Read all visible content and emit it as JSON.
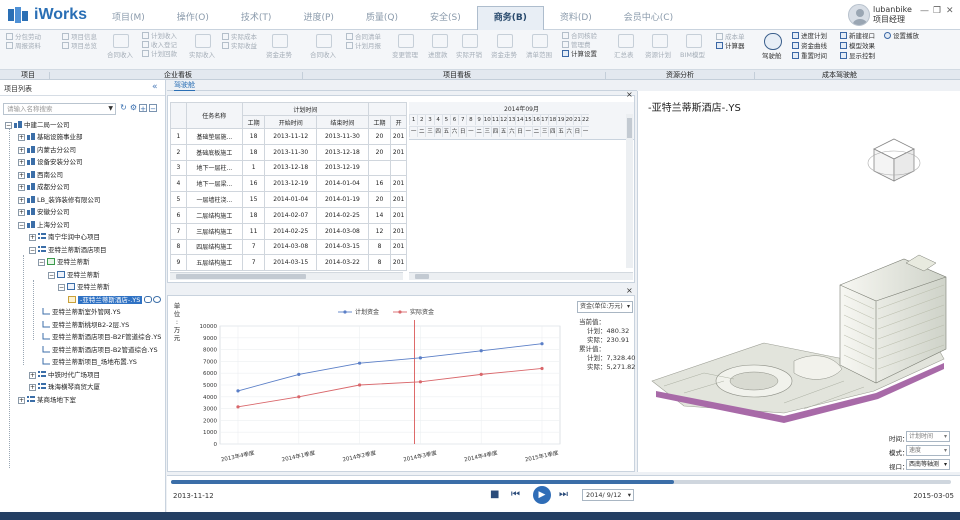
{
  "app": {
    "name": "iWorks"
  },
  "menu": [
    "项目(M)",
    "操作(O)",
    "技术(T)",
    "进度(P)",
    "质量(Q)",
    "安全(S)",
    "商务(B)",
    "资料(D)",
    "会员中心(C)"
  ],
  "user": {
    "name": "lubanbike",
    "role": "项目经理"
  },
  "ribbon": {
    "groups": [
      "项目",
      "企业看板",
      "项目看板",
      "资源分析",
      "成本驾驶舱"
    ],
    "items": {
      "c1": [
        "分包劳动",
        "周报资料"
      ],
      "c2": [
        "项目信息",
        "项目总览"
      ],
      "c3": "合同收入",
      "c4": [
        "计划收入",
        "收入登记",
        "计划回款"
      ],
      "c5": "实际收入",
      "c6": [
        "实际成本",
        "实际收益"
      ],
      "c7": "资金走势",
      "c8": "合同收入",
      "c9": [
        "合同清单",
        "计划月报"
      ],
      "c10": [
        "变更管理",
        "进度款",
        "实际开销",
        "资金走势",
        "清单范围"
      ],
      "c11": [
        "合同核验",
        "管理费"
      ],
      "c12": "计算设置",
      "c13": [
        "汇总表",
        "资源计划",
        "BIM模型"
      ],
      "c14": [
        "成本单",
        "计算器"
      ],
      "c15": "驾驶舱",
      "c16": [
        "进度计划",
        "资金曲线",
        "重置时间"
      ],
      "c17": [
        "新建视口",
        "模型效果",
        "显示控制"
      ],
      "c18": "设置播放"
    }
  },
  "left_panel": {
    "title": "项目列表",
    "search_placeholder": "请输入名称搜索",
    "tree": [
      "中建二局一公司",
      "基础设施事业部",
      "内蒙古分公司",
      "设备安装分公司",
      "西南公司",
      "成都分公司",
      "LB_装饰装修有限公司",
      "安徽分公司",
      "上海分公司",
      "南宁华润中心项目",
      "亚特兰蒂斯酒店项目",
      "亚特兰蒂斯",
      "亚特兰蒂斯",
      "亚特兰蒂斯",
      "-亚特兰蒂斯酒店-.YS",
      "亚特兰蒂斯室外管网.YS",
      "亚特兰蒂斯桃坝B2-2层.YS",
      "亚特兰蒂斯酒店项目-B2F管道综合.YS",
      "亚特兰蒂斯酒店项目-B2管道综合.YS",
      "亚特兰蒂斯项目_场地布置.YS",
      "中铁时代广场项目",
      "珠海横琴商贸大厦",
      "某商场地下室"
    ]
  },
  "tab": {
    "label": "驾驶舱"
  },
  "gantt": {
    "headers": {
      "name": "任务名称",
      "plan": "计划时间",
      "days": "工期",
      "start": "开始时间",
      "end": "结束时间",
      "days2": "工期",
      "start2": "开"
    },
    "rows": [
      [
        "1",
        "基础垫层施...",
        "18",
        "2013-11-12",
        "2013-11-30",
        "20",
        "201"
      ],
      [
        "2",
        "基础底板施工",
        "18",
        "2013-11-30",
        "2013-12-18",
        "20",
        "201"
      ],
      [
        "3",
        "地下一层柱...",
        "1",
        "2013-12-18",
        "2013-12-19",
        "",
        ""
      ],
      [
        "4",
        "地下一层梁...",
        "16",
        "2013-12-19",
        "2014-01-04",
        "16",
        "201"
      ],
      [
        "5",
        "一层墙柱浇...",
        "15",
        "2014-01-04",
        "2014-01-19",
        "20",
        "201"
      ],
      [
        "6",
        "二层结构施工",
        "18",
        "2014-02-07",
        "2014-02-25",
        "14",
        "201"
      ],
      [
        "7",
        "三层结构施工",
        "11",
        "2014-02-25",
        "2014-03-08",
        "12",
        "201"
      ],
      [
        "8",
        "四层结构施工",
        "7",
        "2014-03-08",
        "2014-03-15",
        "8",
        "201"
      ],
      [
        "9",
        "五层结构施工",
        "7",
        "2014-03-15",
        "2014-03-22",
        "8",
        "201"
      ]
    ],
    "month": "2014年09月",
    "days": [
      "1",
      "2",
      "3",
      "4",
      "5",
      "6",
      "7",
      "8",
      "9",
      "10",
      "11",
      "12",
      "13",
      "14",
      "15",
      "16",
      "17",
      "18",
      "19",
      "20",
      "21",
      "22"
    ],
    "weekdays": [
      "一",
      "二",
      "三",
      "四",
      "五",
      "六",
      "日",
      "一",
      "二",
      "三",
      "四",
      "五",
      "六",
      "日",
      "一",
      "二",
      "三",
      "四",
      "五",
      "六",
      "日",
      "一"
    ]
  },
  "chart_data": {
    "type": "line",
    "unit_label": [
      "单",
      "位",
      ":",
      "万",
      "元"
    ],
    "categories": [
      "2013年4季度",
      "2014年1季度",
      "2014年2季度",
      "2014年3季度",
      "2014年4季度",
      "2015年1季度"
    ],
    "series": [
      {
        "name": "计划资金",
        "color": "#5b7fc7",
        "values": [
          4500,
          5900,
          6850,
          7300,
          7900,
          8500
        ]
      },
      {
        "name": "实际资金",
        "color": "#d9676b",
        "values": [
          3150,
          4000,
          5000,
          5271.82,
          5900,
          6400
        ]
      }
    ],
    "ylim": [
      0,
      10000
    ],
    "yticks": [
      0,
      1000,
      2000,
      3000,
      4000,
      5000,
      6000,
      7000,
      8000,
      9000,
      10000
    ],
    "current_marker": "2014年3季度"
  },
  "chart_panel": {
    "select": "资金(单位:万元)",
    "info": [
      "当前值：",
      "计划：480.32",
      "实际：230.91",
      "累计值：",
      "计划：7,328.40",
      "实际：5,271.82"
    ]
  },
  "viewer": {
    "title": "-亚特兰蒂斯酒店-.YS",
    "controls": [
      {
        "label": "时间：",
        "value": "计划时间"
      },
      {
        "label": "模式：",
        "value": "速度"
      },
      {
        "label": "视口：",
        "value": "西南等轴测"
      }
    ]
  },
  "timeline": {
    "start": "2013-11-12",
    "end": "2015-03-05",
    "current": "2014/ 9/12",
    "progress": 0.645
  }
}
